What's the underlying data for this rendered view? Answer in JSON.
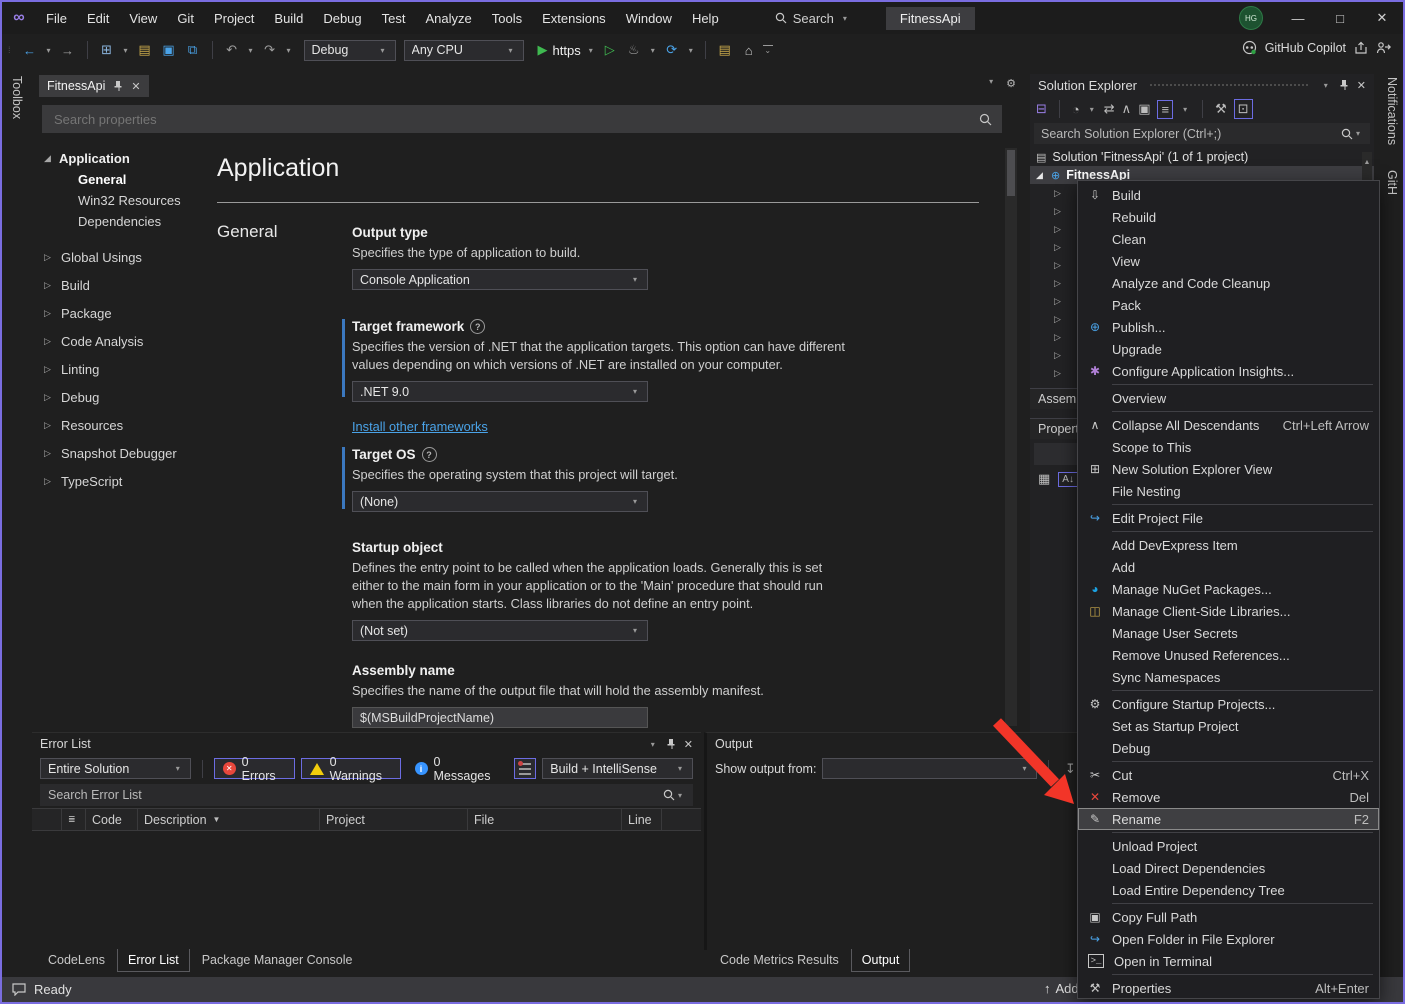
{
  "titlebar": {
    "menus": [
      "File",
      "Edit",
      "View",
      "Git",
      "Project",
      "Build",
      "Debug",
      "Test",
      "Analyze",
      "Tools",
      "Extensions",
      "Window",
      "Help"
    ],
    "search_label": "Search",
    "window_title": "FitnessApi",
    "avatar_initials": "HG"
  },
  "toolbar": {
    "config": "Debug",
    "platform": "Any CPU",
    "run_profile": "https",
    "copilot_label": "GitHub Copilot"
  },
  "left_strip": {
    "toolbox": "Toolbox"
  },
  "right_strip": {
    "notifications": "Notifications",
    "github": "GitH"
  },
  "editor": {
    "tab": "FitnessApi",
    "search_placeholder": "Search properties",
    "page_title": "Application",
    "section": "General",
    "nav": {
      "root": "Application",
      "children": [
        "General",
        "Win32 Resources",
        "Dependencies"
      ],
      "sections": [
        "Global Usings",
        "Build",
        "Package",
        "Code Analysis",
        "Linting",
        "Debug",
        "Resources",
        "Snapshot Debugger",
        "TypeScript"
      ]
    },
    "fields": [
      {
        "label": "Output type",
        "desc": "Specifies the type of application to build.",
        "value": "Console Application"
      },
      {
        "label": "Target framework",
        "desc": "Specifies the version of .NET that the application targets. This option can have different values depending on which versions of .NET are installed on your computer.",
        "value": ".NET 9.0",
        "link": "Install other frameworks"
      },
      {
        "label": "Target OS",
        "desc": "Specifies the operating system that this project will target.",
        "value": "(None)"
      },
      {
        "label": "Startup object",
        "desc": "Defines the entry point to be called when the application loads. Generally this is set either to the main form in your application or to the 'Main' procedure that should run when the application starts. Class libraries do not define an entry point.",
        "value": "(Not set)"
      },
      {
        "label": "Assembly name",
        "desc": "Specifies the name of the output file that will hold the assembly manifest.",
        "value": "$(MSBuildProjectName)"
      }
    ]
  },
  "error_list": {
    "title": "Error List",
    "scope": "Entire Solution",
    "errors": "0 Errors",
    "warnings": "0 Warnings",
    "messages": "0 Messages",
    "build_filter": "Build + IntelliSense",
    "search_placeholder": "Search Error List",
    "columns": [
      "Code",
      "Description",
      "Project",
      "File",
      "Line"
    ],
    "tabs": [
      "CodeLens",
      "Error List",
      "Package Manager Console"
    ]
  },
  "output": {
    "title": "Output",
    "show_from": "Show output from:",
    "tabs": [
      "Code Metrics Results",
      "Output"
    ]
  },
  "solution_explorer": {
    "title": "Solution Explorer",
    "search_placeholder": "Search Solution Explorer (Ctrl+;)",
    "solution": "Solution 'FitnessApi' (1 of 1 project)",
    "project": "FitnessApi",
    "panes": [
      "Assembly Explorer",
      "Properties"
    ]
  },
  "context_menu": {
    "items": [
      {
        "label": "Build"
      },
      {
        "label": "Rebuild"
      },
      {
        "label": "Clean"
      },
      {
        "label": "View"
      },
      {
        "label": "Analyze and Code Cleanup"
      },
      {
        "label": "Pack"
      },
      {
        "label": "Publish..."
      },
      {
        "label": "Upgrade"
      },
      {
        "label": "Configure Application Insights..."
      },
      {
        "label": "Overview"
      },
      {
        "label": "Collapse All Descendants",
        "shortcut": "Ctrl+Left Arrow"
      },
      {
        "label": "Scope to This"
      },
      {
        "label": "New Solution Explorer View"
      },
      {
        "label": "File Nesting"
      },
      {
        "label": "Edit Project File"
      },
      {
        "label": "Add DevExpress Item"
      },
      {
        "label": "Add"
      },
      {
        "label": "Manage NuGet Packages..."
      },
      {
        "label": "Manage Client-Side Libraries..."
      },
      {
        "label": "Manage User Secrets"
      },
      {
        "label": "Remove Unused References..."
      },
      {
        "label": "Sync Namespaces"
      },
      {
        "label": "Configure Startup Projects..."
      },
      {
        "label": "Set as Startup Project"
      },
      {
        "label": "Debug"
      },
      {
        "label": "Cut",
        "shortcut": "Ctrl+X"
      },
      {
        "label": "Remove",
        "shortcut": "Del"
      },
      {
        "label": "Rename",
        "shortcut": "F2"
      },
      {
        "label": "Unload Project"
      },
      {
        "label": "Load Direct Dependencies"
      },
      {
        "label": "Load Entire Dependency Tree"
      },
      {
        "label": "Copy Full Path"
      },
      {
        "label": "Open Folder in File Explorer"
      },
      {
        "label": "Open in Terminal"
      },
      {
        "label": "Properties",
        "shortcut": "Alt+Enter"
      }
    ]
  },
  "status_bar": {
    "ready": "Ready",
    "right": "Add"
  },
  "icons": {
    "back": "←",
    "forward": "→",
    "undo": "↶",
    "redo": "↷",
    "play": "▶",
    "play_outline": "▷",
    "flame": "♨",
    "refresh": "⟳",
    "chevron_down": "▾",
    "close": "✕",
    "minimize": "—",
    "maximize": "□",
    "build": "⇩",
    "publish": "⊕",
    "insights": "✱",
    "collapse": "∧",
    "new_view": "⊞",
    "edit_file": "↪",
    "nuget": "◕",
    "client_libs": "◫",
    "gear": "⚙",
    "cut": "✂",
    "remove_x": "✕",
    "rename": "✎",
    "copy": "▣",
    "terminal": ">_",
    "wrench": "⚒",
    "home": "⌂",
    "tree_collapsed": "▷",
    "tree_expanded": "◢",
    "globe": "⊕",
    "solution": "▤",
    "sort": "A↓",
    "category": "▦",
    "arrow_up": "↑",
    "overflow": "⌄",
    "folder": "▤",
    "new_project": "⊞",
    "save": "▣",
    "save_all": "⧉",
    "sort_desc": "▼",
    "up": "▲"
  },
  "colors": {
    "accent_purple": "#6c6ce2",
    "window_border": "#7a6de0",
    "error_red": "#e8473c",
    "warning_yellow": "#f2cc0c",
    "info_blue": "#3794ff",
    "link_blue": "#4aa3e8",
    "arrow_red": "#f23528",
    "run_green": "#3fb950",
    "field_accent": "#3b78bf"
  }
}
